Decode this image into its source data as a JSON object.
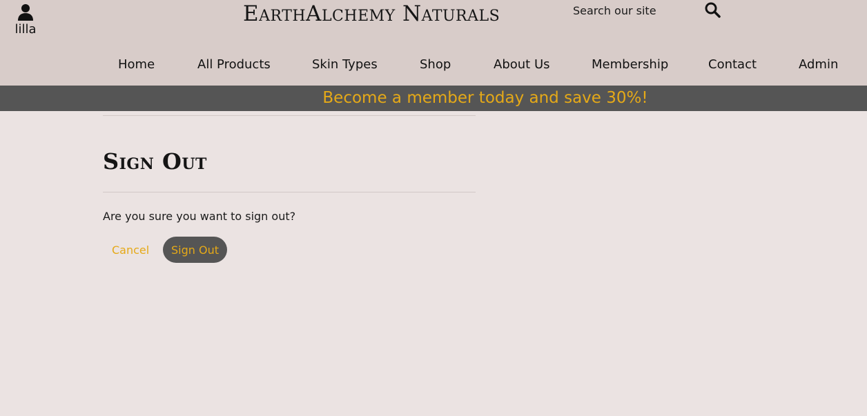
{
  "header": {
    "username": "lilla",
    "brand": "EarthAlchemy Naturals",
    "search": {
      "placeholder": "Search our site"
    },
    "nav": [
      {
        "label": "Home"
      },
      {
        "label": "All Products"
      },
      {
        "label": "Skin Types"
      },
      {
        "label": "Shop"
      },
      {
        "label": "About Us"
      },
      {
        "label": "Membership"
      },
      {
        "label": "Contact"
      },
      {
        "label": "Admin"
      }
    ]
  },
  "promo": {
    "text": "Become a member today and save 30%!"
  },
  "main": {
    "title": "Sign Out",
    "question": "Are you sure you want to sign out?",
    "cancel_label": "Cancel",
    "signout_label": "Sign Out"
  },
  "colors": {
    "header_bg": "#d8ccc9",
    "page_bg": "#ebe3e2",
    "accent": "#e5a918",
    "dark": "#555555"
  },
  "icons": {
    "account": "user-icon",
    "search": "search-icon"
  }
}
